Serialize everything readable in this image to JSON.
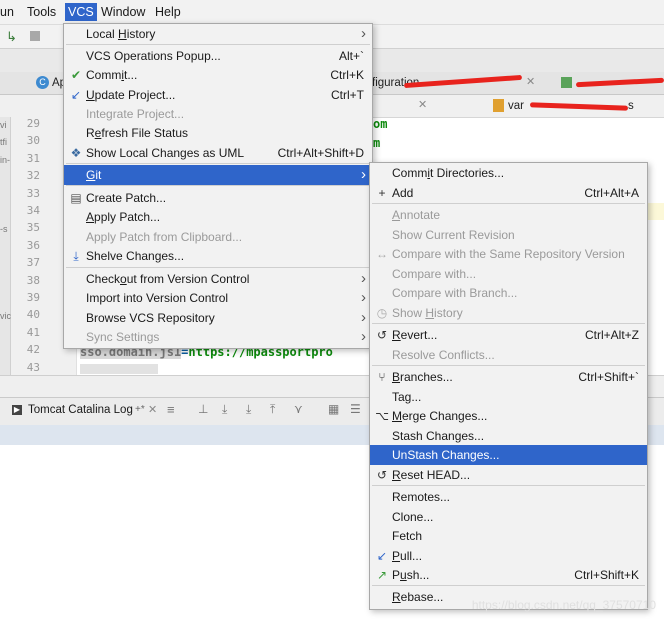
{
  "menubar": {
    "items": [
      "un",
      "Tools",
      "VCS",
      "Window",
      "Help"
    ],
    "active": "VCS"
  },
  "tabs": {
    "first": "Ap",
    "config": "figuration",
    "var_file": "var",
    "var_suffix": "s"
  },
  "gutter": {
    "lines": [
      "29",
      "30",
      "31",
      "32",
      "33",
      "34",
      "35",
      "36",
      "37",
      "38",
      "39",
      "40",
      "41",
      "42",
      "43"
    ],
    "side_labels": [
      "vi",
      "tfi",
      "in-",
      "",
      "",
      "",
      "-s",
      "",
      "",
      "",
      "",
      "vic",
      "",
      "",
      ""
    ]
  },
  "editor": {
    "frag1": "om",
    "frag2": "m",
    "code_key": "sso.domain.js1",
    "code_eq": "=",
    "code_val": "https://mpassportpro"
  },
  "run_bar": {
    "tab_label": "Tomcat Catalina Log",
    "tab_suffix": "+*"
  },
  "vcs_menu": {
    "items": [
      {
        "label": "Local History",
        "shortcut": "",
        "submenu": true,
        "disabled": false,
        "icon": ""
      },
      {
        "label": "VCS Operations Popup...",
        "shortcut": "Alt+`",
        "submenu": false,
        "disabled": false,
        "icon": ""
      },
      {
        "label": "Commit...",
        "shortcut": "Ctrl+K",
        "submenu": false,
        "disabled": false,
        "icon": "check-icon"
      },
      {
        "label": "Update Project...",
        "shortcut": "Ctrl+T",
        "submenu": false,
        "disabled": false,
        "icon": "update-arrow-icon"
      },
      {
        "label": "Integrate Project...",
        "shortcut": "",
        "submenu": false,
        "disabled": true,
        "icon": ""
      },
      {
        "label": "Refresh File Status",
        "shortcut": "",
        "submenu": false,
        "disabled": false,
        "icon": ""
      },
      {
        "label": "Show Local Changes as UML",
        "shortcut": "Ctrl+Alt+Shift+D",
        "submenu": false,
        "disabled": false,
        "icon": "uml-icon"
      },
      {
        "label": "Git",
        "shortcut": "",
        "submenu": true,
        "disabled": false,
        "icon": "",
        "selected": true
      },
      {
        "label": "Create Patch...",
        "shortcut": "",
        "submenu": false,
        "disabled": false,
        "icon": "patch-icon"
      },
      {
        "label": "Apply Patch...",
        "shortcut": "",
        "submenu": false,
        "disabled": false,
        "icon": ""
      },
      {
        "label": "Apply Patch from Clipboard...",
        "shortcut": "",
        "submenu": false,
        "disabled": true,
        "icon": ""
      },
      {
        "label": "Shelve Changes...",
        "shortcut": "",
        "submenu": false,
        "disabled": false,
        "icon": "shelve-icon"
      },
      {
        "label": "Checkout from Version Control",
        "shortcut": "",
        "submenu": true,
        "disabled": false,
        "icon": ""
      },
      {
        "label": "Import into Version Control",
        "shortcut": "",
        "submenu": true,
        "disabled": false,
        "icon": ""
      },
      {
        "label": "Browse VCS Repository",
        "shortcut": "",
        "submenu": true,
        "disabled": false,
        "icon": ""
      },
      {
        "label": "Sync Settings",
        "shortcut": "",
        "submenu": true,
        "disabled": true,
        "icon": ""
      }
    ]
  },
  "git_menu": {
    "items": [
      {
        "label": "Commit Directories...",
        "shortcut": "",
        "disabled": false,
        "icon": ""
      },
      {
        "label": "Add",
        "shortcut": "Ctrl+Alt+A",
        "disabled": false,
        "icon": "plus-icon"
      },
      {
        "label": "Annotate",
        "shortcut": "",
        "disabled": true,
        "icon": ""
      },
      {
        "label": "Show Current Revision",
        "shortcut": "",
        "disabled": true,
        "icon": ""
      },
      {
        "label": "Compare with the Same Repository Version",
        "shortcut": "",
        "disabled": true,
        "icon": "compare-icon"
      },
      {
        "label": "Compare with...",
        "shortcut": "",
        "disabled": true,
        "icon": ""
      },
      {
        "label": "Compare with Branch...",
        "shortcut": "",
        "disabled": true,
        "icon": ""
      },
      {
        "label": "Show History",
        "shortcut": "",
        "disabled": true,
        "icon": "history-icon"
      },
      {
        "label": "Revert...",
        "shortcut": "Ctrl+Alt+Z",
        "disabled": false,
        "icon": "revert-icon"
      },
      {
        "label": "Resolve Conflicts...",
        "shortcut": "",
        "disabled": true,
        "icon": ""
      },
      {
        "label": "Branches...",
        "shortcut": "Ctrl+Shift+`",
        "disabled": false,
        "icon": "branch-icon"
      },
      {
        "label": "Tag...",
        "shortcut": "",
        "disabled": false,
        "icon": ""
      },
      {
        "label": "Merge Changes...",
        "shortcut": "",
        "disabled": false,
        "icon": "merge-icon"
      },
      {
        "label": "Stash Changes...",
        "shortcut": "",
        "disabled": false,
        "icon": ""
      },
      {
        "label": "UnStash Changes...",
        "shortcut": "",
        "disabled": false,
        "icon": "",
        "selected": true
      },
      {
        "label": "Reset HEAD...",
        "shortcut": "",
        "disabled": false,
        "icon": "reset-icon"
      },
      {
        "label": "Remotes...",
        "shortcut": "",
        "disabled": false,
        "icon": ""
      },
      {
        "label": "Clone...",
        "shortcut": "",
        "disabled": false,
        "icon": ""
      },
      {
        "label": "Fetch",
        "shortcut": "",
        "disabled": false,
        "icon": ""
      },
      {
        "label": "Pull...",
        "shortcut": "",
        "disabled": false,
        "icon": "pull-icon"
      },
      {
        "label": "Push...",
        "shortcut": "Ctrl+Shift+K",
        "disabled": false,
        "icon": "push-icon"
      },
      {
        "label": "Rebase...",
        "shortcut": "",
        "disabled": false,
        "icon": ""
      }
    ]
  },
  "watermark": "https://blog.csdn.net/qq_37570710",
  "colors": {
    "selection": "#2f65ca",
    "menu_bg": "#f2f2f2",
    "disabled_text": "#9a9a9a",
    "code_green": "#0d8a0d",
    "redaction": "#e8231d"
  }
}
